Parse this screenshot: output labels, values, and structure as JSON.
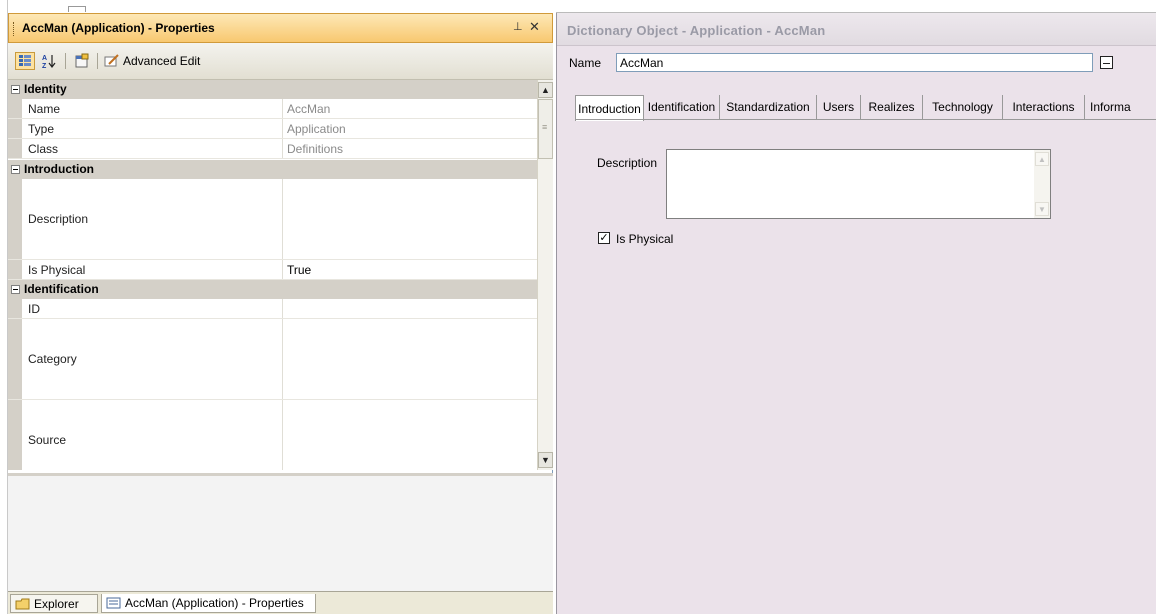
{
  "properties_panel": {
    "title": "AccMan (Application) - Properties",
    "pin_icon": "pin-icon",
    "close_label": "✕",
    "toolbar": {
      "categorized_icon": "categorized-icon",
      "alphabetical_icon": "sort-alpha-icon",
      "property_pages_icon": "property-pages-icon",
      "advanced_edit_label": "Advanced Edit"
    },
    "categories": [
      {
        "label": "Identity",
        "rows": [
          {
            "name": "Name",
            "value": "AccMan",
            "readonly": true
          },
          {
            "name": "Type",
            "value": "Application",
            "readonly": true
          },
          {
            "name": "Class",
            "value": "Definitions",
            "readonly": true
          }
        ]
      },
      {
        "label": "Introduction",
        "rows": [
          {
            "name": "Description",
            "value": "",
            "readonly": false
          },
          {
            "name": "Is Physical",
            "value": "True",
            "readonly": false
          }
        ]
      },
      {
        "label": "Identification",
        "rows": [
          {
            "name": "ID",
            "value": "",
            "readonly": false
          },
          {
            "name": "Category",
            "value": "",
            "readonly": false
          },
          {
            "name": "Source",
            "value": "",
            "readonly": false
          }
        ]
      }
    ],
    "bottom_tabs": [
      {
        "label": "Explorer",
        "icon": "explorer-icon"
      },
      {
        "label": "AccMan (Application) - Properties",
        "icon": "properties-icon"
      }
    ]
  },
  "dictionary_panel": {
    "title": "Dictionary Object - Application - AccMan",
    "name_label": "Name",
    "name_value": "AccMan",
    "tabs": [
      {
        "label": "Introduction",
        "active": true
      },
      {
        "label": "Identification",
        "active": false
      },
      {
        "label": "Standardization",
        "active": false
      },
      {
        "label": "Users",
        "active": false
      },
      {
        "label": "Realizes",
        "active": false
      },
      {
        "label": "Technology",
        "active": false
      },
      {
        "label": "Interactions",
        "active": false
      },
      {
        "label": "Informa",
        "active": false
      }
    ],
    "description_label": "Description",
    "description_value": "",
    "is_physical_label": "Is Physical",
    "is_physical_checked": true
  }
}
